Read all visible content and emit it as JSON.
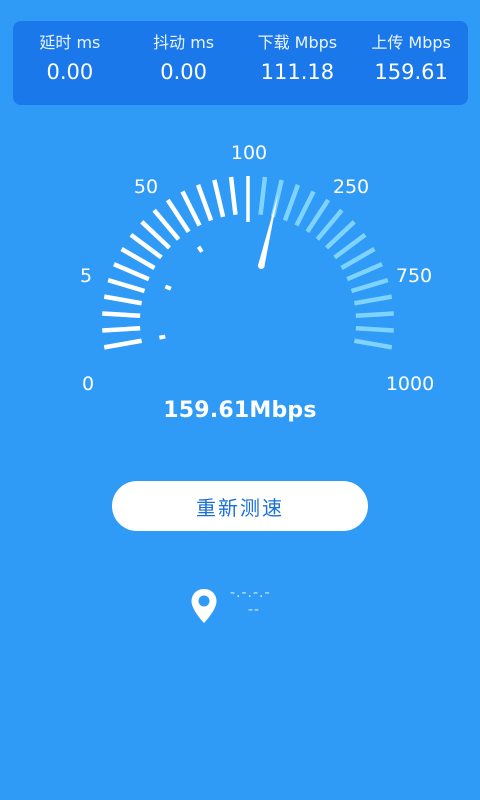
{
  "stats": [
    {
      "label": "延时 ms",
      "value": "0.00"
    },
    {
      "label": "抖动 ms",
      "value": "0.00"
    },
    {
      "label": "下载 Mbps",
      "value": "111.18"
    },
    {
      "label": "上传 Mbps",
      "value": "159.61"
    }
  ],
  "gauge": {
    "scale_labels": [
      "0",
      "5",
      "50",
      "100",
      "250",
      "750",
      "1000"
    ],
    "needle_value_mbps": 159.61,
    "active_color": "#ffffff",
    "inactive_color": "#7fd3ff"
  },
  "speed_readout": "159.61Mbps",
  "retest_button": {
    "label": "重新测速"
  },
  "location": {
    "icon": "location-pin-icon",
    "line1": "-.-.-.-",
    "line2": "--"
  },
  "colors": {
    "background": "#2f9bf6",
    "panel": "#1a78ea",
    "button_text": "#1a6fd8"
  }
}
